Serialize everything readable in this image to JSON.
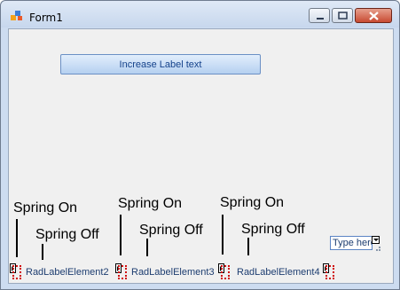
{
  "window": {
    "title": "Form1"
  },
  "buttons": {
    "increase_label": "Increase Label text"
  },
  "notes": [
    {
      "text": "Spring On"
    },
    {
      "text": "Spring Off"
    },
    {
      "text": "Spring On"
    },
    {
      "text": "Spring Off"
    },
    {
      "text": "Spring On"
    },
    {
      "text": "Spring Off"
    }
  ],
  "status": {
    "labels": [
      "RadLabelElement2",
      "RadLabelElement3",
      "RadLabelElement4"
    ],
    "typehere": "Type here"
  },
  "colors": {
    "accent": "#6b90c5",
    "dotted_border": "#d01010",
    "title_text": "#000000"
  }
}
